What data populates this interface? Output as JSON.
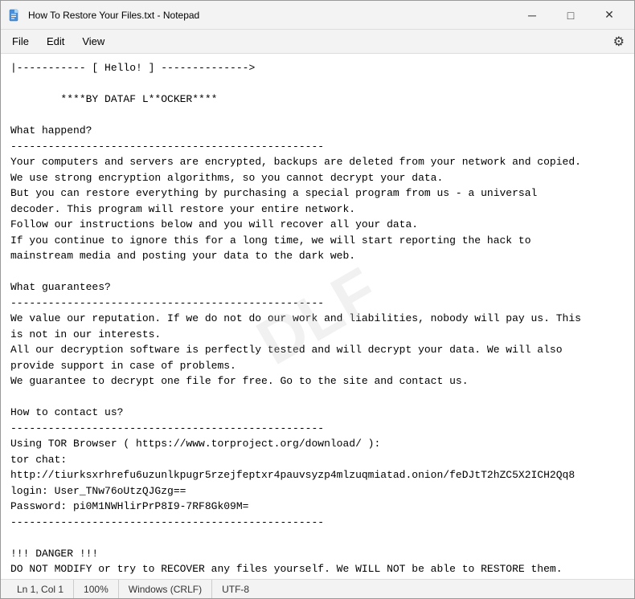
{
  "window": {
    "title": "How To Restore Your Files.txt - Notepad",
    "icon": "notepad"
  },
  "menu": {
    "file_label": "File",
    "edit_label": "Edit",
    "view_label": "View"
  },
  "titlebar": {
    "minimize_label": "─",
    "maximize_label": "□",
    "close_label": "✕"
  },
  "content": {
    "text": "|----------- [ Hello! ] -------------->\n\n        ****BY DATAF L**OCKER****\n\nWhat happend?\n--------------------------------------------------\nYour computers and servers are encrypted, backups are deleted from your network and copied.\nWe use strong encryption algorithms, so you cannot decrypt your data.\nBut you can restore everything by purchasing a special program from us - a universal\ndecoder. This program will restore your entire network.\nFollow our instructions below and you will recover all your data.\nIf you continue to ignore this for a long time, we will start reporting the hack to\nmainstream media and posting your data to the dark web.\n\nWhat guarantees?\n--------------------------------------------------\nWe value our reputation. If we do not do our work and liabilities, nobody will pay us. This\nis not in our interests.\nAll our decryption software is perfectly tested and will decrypt your data. We will also\nprovide support in case of problems.\nWe guarantee to decrypt one file for free. Go to the site and contact us.\n\nHow to contact us?\n--------------------------------------------------\nUsing TOR Browser ( https://www.torproject.org/download/ ):\ntor chat:\nhttp://tiurksxrhrefu6uzunlkpugr5rzejfeptxr4pauvsyzp4mlzuqmiatad.onion/feDJtT2hZC5X2ICH2Qq8\nlogin: User_TNw76oUtzQJGzg==\nPassword: pi0M1NWHlirPrP8I9-7RF8Gk09M=\n--------------------------------------------------\n\n!!! DANGER !!!\nDO NOT MODIFY or try to RECOVER any files yourself. We WILL NOT be able to RESTORE them.\n!!! DANGER !!"
  },
  "statusbar": {
    "position": "Ln 1, Col 1",
    "zoom": "100%",
    "line_ending": "Windows (CRLF)",
    "encoding": "UTF-8"
  }
}
